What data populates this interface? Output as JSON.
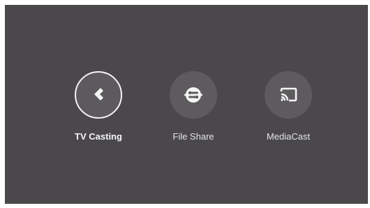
{
  "apps": [
    {
      "label": "TV Casting",
      "icon": "tv-casting-icon",
      "selected": true
    },
    {
      "label": "File Share",
      "icon": "file-share-icon",
      "selected": false
    },
    {
      "label": "MediaCast",
      "icon": "cast-icon",
      "selected": false
    }
  ],
  "colors": {
    "background": "#4a484b",
    "icon_circle": "#5e5b5f",
    "focus_ring": "#f4f4f4",
    "label": "#e4e4e4"
  }
}
